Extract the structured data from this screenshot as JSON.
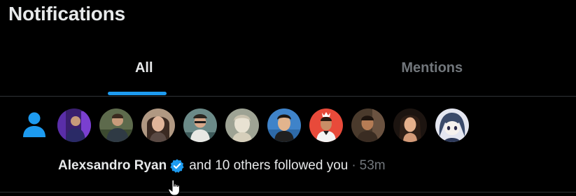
{
  "header": {
    "title": "Notifications"
  },
  "tabs": [
    {
      "label": "All",
      "active": true
    },
    {
      "label": "Mentions",
      "active": false
    }
  ],
  "colors": {
    "accent": "#1d9bf0",
    "background": "#000000",
    "text_primary": "#e7e9ea",
    "text_secondary": "#71767b",
    "divider": "#2f3336"
  },
  "notification": {
    "type_icon": "person-icon",
    "user_name": "Alexsandro Ryan",
    "verified_icon": "verified-badge-icon",
    "action": "and 10 others followed you",
    "separator": "·",
    "time": "53m",
    "avatars": [
      {
        "name": "avatar-1"
      },
      {
        "name": "avatar-2"
      },
      {
        "name": "avatar-3"
      },
      {
        "name": "avatar-4"
      },
      {
        "name": "avatar-5"
      },
      {
        "name": "avatar-6"
      },
      {
        "name": "avatar-7"
      },
      {
        "name": "avatar-8"
      },
      {
        "name": "avatar-9"
      },
      {
        "name": "avatar-10"
      }
    ]
  }
}
